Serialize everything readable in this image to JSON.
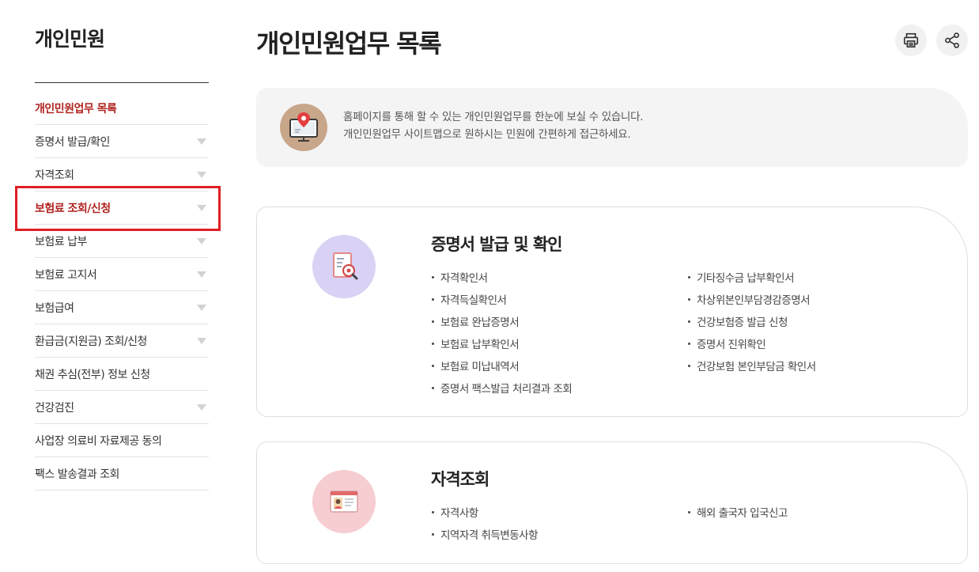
{
  "sidebar": {
    "title": "개인민원",
    "items": [
      {
        "label": "개인민원업무 목록",
        "expandable": false
      },
      {
        "label": "증명서 발급/확인",
        "expandable": true
      },
      {
        "label": "자격조회",
        "expandable": true
      },
      {
        "label": "보험료 조회/신청",
        "expandable": true
      },
      {
        "label": "보험료 납부",
        "expandable": true
      },
      {
        "label": "보험료 고지서",
        "expandable": true
      },
      {
        "label": "보험급여",
        "expandable": true
      },
      {
        "label": "환급금(지원금) 조회/신청",
        "expandable": true
      },
      {
        "label": "채권 추심(전부) 정보 신청",
        "expandable": false
      },
      {
        "label": "건강검진",
        "expandable": true
      },
      {
        "label": "사업장 의료비 자료제공 동의",
        "expandable": false
      },
      {
        "label": "팩스 발송결과 조회",
        "expandable": false
      }
    ]
  },
  "main": {
    "title": "개인민원업무 목록",
    "intro": {
      "line1": "홈페이지를 통해 할 수 있는 개인민원업무를 한눈에 보실 수 있습니다.",
      "line2": "개인민원업무 사이트맵으로 원하시는 민원에 간편하게 접근하세요."
    },
    "cards": [
      {
        "title": "증명서 발급 및 확인",
        "icon": "document-search-icon",
        "left": [
          "자격확인서",
          "자격득실확인서",
          "보험료 완납증명서",
          "보험료 납부확인서",
          "보험료 미납내역서",
          "증명서 팩스발급 처리결과 조회"
        ],
        "right": [
          "기타징수금 납부확인서",
          "차상위본인부담경감증명서",
          "건강보험증 발급 신청",
          "증명서 진위확인",
          "건강보험 본인부담금 확인서"
        ]
      },
      {
        "title": "자격조회",
        "icon": "id-card-icon",
        "left": [
          "자격사항",
          "지역자격 취득변동사항"
        ],
        "right": [
          "해외 출국자 입국신고"
        ]
      }
    ]
  },
  "colors": {
    "accent": "#b0231f",
    "highlight": "#e01e25"
  }
}
